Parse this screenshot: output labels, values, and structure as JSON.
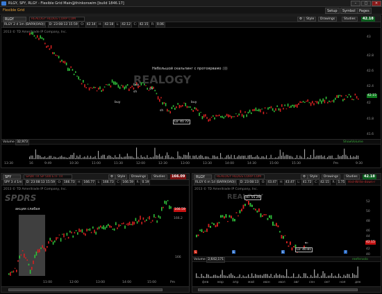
{
  "window": {
    "title": "RLGY, SPY, RLGY - Flexible Grid Main@thinkorswim [build 1846.17]",
    "minimize": "–",
    "maximize": "□",
    "close": "✕"
  },
  "toolbar": {
    "grid_menu": "Flexible Grid",
    "items": [
      "Setup",
      "Symbol",
      "Pages"
    ]
  },
  "top_panel": {
    "symbol": "RLGY",
    "linked": "REALOGY HLDGS CORP COM",
    "style": "Style",
    "drawings": "Drawings",
    "studies": "Studies",
    "price": "42.18",
    "quote": [
      "RLGY 2 d 1m (BAR9(0A0))",
      "D: 23:08:13 15:59",
      "O:",
      "42.14",
      "H:",
      "42.18",
      "L:",
      "42.12",
      "C:",
      "42.15",
      "R:",
      "0.06"
    ],
    "copyright": "2013 © TD Ameritrade IP Company, Inc.",
    "logo": "REALOGY",
    "annotation": "Небольшой скальпинг с протоярвамо :)))",
    "labels": {
      "buy1": "buy",
      "buy2": "buy",
      "buy3": "buy",
      "sh1": "sh",
      "sh2": "sh",
      "sh3": "sh",
      "lo": "Lo: 41.72"
    },
    "price_axis": [
      "43",
      "42.8",
      "42.6",
      "42.4",
      "42",
      "41.8",
      "41.6"
    ],
    "price_tag": "42.15",
    "volume_label": "Volume",
    "volume_value": "32,973",
    "volume_tag": "ShowVolume",
    "time_axis": [
      "13:30",
      "16",
      "9:49",
      "10:30",
      "11:00",
      "11:30",
      "12:00",
      "12:30",
      "13:00",
      "13:30",
      "14:00",
      "14:30",
      "15:00",
      "15:30",
      "Pm",
      "9:30"
    ]
  },
  "left_panel": {
    "symbol": "SPY",
    "linked": "SPDR TR SP 500 ETF TR",
    "style": "Style",
    "drawings": "Drawings",
    "studies": "Studies",
    "price": "166.09",
    "quote": [
      "SPY 3 d 1m",
      "D: 23:08:13 15:59",
      "O:",
      "166.73",
      "H:",
      "166.77",
      "L:",
      "166.73",
      "C:",
      "166.59",
      "R:",
      "0.19"
    ],
    "copyright": "2013 © TD Ameritrade IP Company, Inc.",
    "logo": "SPDRS",
    "annotation": "акция слабая",
    "price_tag": "166.59",
    "price_axis": [
      "166.2",
      "166"
    ],
    "time_axis": [
      "11:00",
      "12:00",
      "13:00",
      "14:00",
      "15:00",
      "Pm"
    ]
  },
  "right_panel": {
    "symbol": "RLGY",
    "linked": "REALOGY HLDGS CORP COM",
    "style": "Style",
    "drawings": "Drawings",
    "studies": "Studies",
    "price": "42.18",
    "quote": [
      "RLGY 6 m 1d (BAR9(0A0))",
      "D: 23:08:13",
      "O:",
      "43.47",
      "H:",
      "43.47",
      "L:",
      "41.72",
      "C:",
      "42.15",
      "R:",
      "1.75",
      "Hist-Write-down-r"
    ],
    "copyright": "2013 © TD Ameritrade IP Company, Inc.",
    "logo": "REALOGY",
    "labels": {
      "hi": "Hi: 55.29",
      "lo": "Lo: 40.81"
    },
    "price_axis": [
      "52",
      "50",
      "48",
      "46",
      "44",
      "42",
      "40"
    ],
    "price_tag": "42.15",
    "volume_label": "Volume",
    "volume_value": "2,642,171",
    "volume_tag": "reefervolo",
    "time_axis": [
      "фев",
      "мар",
      "апр",
      "май",
      "июн",
      "июл",
      "авг",
      "сен",
      "окт",
      "ноя",
      "дек"
    ]
  },
  "colors": {
    "up": "#2fbf3a",
    "down": "#d42020",
    "neutral": "#9a9a9a",
    "volume": "#a8a8a8"
  },
  "icons": {
    "app": "thinkorswim-icon",
    "settings": "gear-icon",
    "link": "link-icon"
  }
}
